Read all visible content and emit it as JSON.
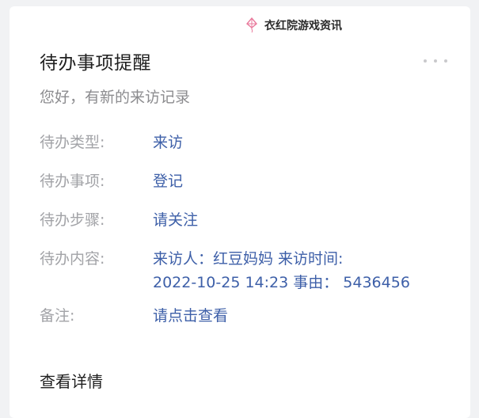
{
  "watermark": {
    "text": "衣红院游戏资讯"
  },
  "card": {
    "title": "待办事项提醒",
    "subtitle": "您好，有新的来访记录",
    "fields": [
      {
        "label": "待办类型:",
        "value": "来访"
      },
      {
        "label": "待办事项:",
        "value": "登记"
      },
      {
        "label": "待办步骤:",
        "value": "请关注"
      },
      {
        "label": "待办内容:",
        "value_line1": "来访人：红豆妈妈 来访时间:",
        "value_line2": "2022-10-25 14:23 事由： 5436456"
      },
      {
        "label": "备注:",
        "value": "请点击查看"
      }
    ],
    "detail_link": "查看详情"
  },
  "colors": {
    "value_blue": "#3d5fa8",
    "label_gray": "#a2a3a7",
    "kite_pink": "#e97a9c"
  }
}
